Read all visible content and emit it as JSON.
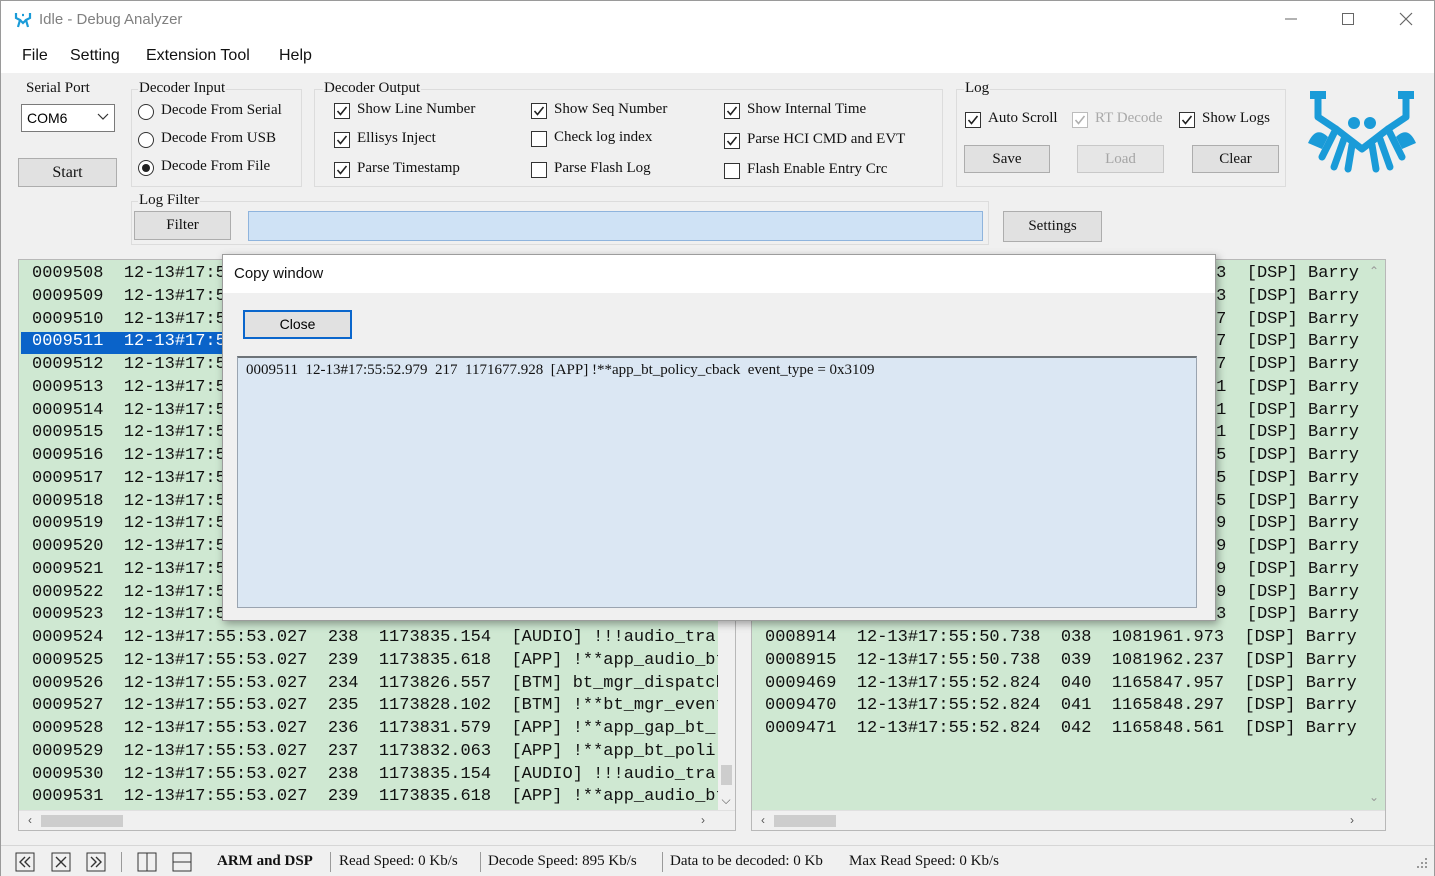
{
  "window": {
    "title": "Idle - Debug Analyzer",
    "minimize_icon": "minimize-icon",
    "maximize_icon": "maximize-icon",
    "close_icon": "close-icon"
  },
  "menu": [
    "File",
    "Setting",
    "Extension Tool",
    "Help"
  ],
  "serial_port": {
    "label": "Serial Port",
    "selected": "COM6",
    "start_label": "Start"
  },
  "decoder_input": {
    "label": "Decoder Input",
    "options": [
      {
        "label": "Decode From Serial",
        "checked": false
      },
      {
        "label": "Decode From USB",
        "checked": false
      },
      {
        "label": "Decode From File",
        "checked": true
      }
    ]
  },
  "decoder_output": {
    "label": "Decoder Output",
    "options": [
      {
        "label": "Show Line Number",
        "checked": true
      },
      {
        "label": "Ellisys Inject",
        "checked": true
      },
      {
        "label": "Parse Timestamp",
        "checked": true
      },
      {
        "label": "Show Seq Number",
        "checked": true
      },
      {
        "label": "Check log index",
        "checked": false
      },
      {
        "label": "Parse Flash Log",
        "checked": false
      },
      {
        "label": "Show Internal Time",
        "checked": true
      },
      {
        "label": "Parse HCI CMD and EVT",
        "checked": true
      },
      {
        "label": "Flash Enable Entry Crc",
        "checked": false
      }
    ]
  },
  "log": {
    "label": "Log",
    "auto_scroll": {
      "label": "Auto Scroll",
      "checked": true
    },
    "rt_decode": {
      "label": "RT Decode",
      "checked": true,
      "disabled": true
    },
    "show_logs": {
      "label": "Show Logs",
      "checked": true
    },
    "save_label": "Save",
    "load_label": "Load",
    "clear_label": "Clear"
  },
  "log_filter": {
    "label": "Log Filter",
    "filter_label": "Filter",
    "value": "",
    "settings_label": "Settings"
  },
  "left_log": {
    "lines": [
      "0009508  12-13#17:5",
      "0009509  12-13#17:5",
      "0009510  12-13#17:5",
      "0009511  12-13#17:5",
      "0009512  12-13#17:5",
      "0009513  12-13#17:5",
      "0009514  12-13#17:5",
      "0009515  12-13#17:5",
      "0009516  12-13#17:5",
      "0009517  12-13#17:5",
      "0009518  12-13#17:5",
      "0009519  12-13#17:5",
      "0009520  12-13#17:5",
      "0009521  12-13#17:5",
      "0009522  12-13#17:5",
      "0009523  12-13#17:5",
      "0009524  12-13#17:55:53.027  238  1173835.154  [AUDIO] !!!audio_tra",
      "0009525  12-13#17:55:53.027  239  1173835.618  [APP] !**app_audio_bt",
      "0009526  12-13#17:55:53.027  234  1173826.557  [BTM] bt_mgr_dispatch",
      "0009527  12-13#17:55:53.027  235  1173828.102  [BTM] !**bt_mgr_event",
      "0009528  12-13#17:55:53.027  236  1173831.579  [APP] !**app_gap_bt_",
      "0009529  12-13#17:55:53.027  237  1173832.063  [APP] !**app_bt_poli",
      "0009530  12-13#17:55:53.027  238  1173835.154  [AUDIO] !!!audio_tra",
      "0009531  12-13#17:55:53.027  239  1173835.618  [APP] !**app_audio_bt"
    ],
    "selected_index": 3
  },
  "right_log": {
    "lines": [
      "3  [DSP] Barry",
      "3  [DSP] Barry",
      "7  [DSP] Barry",
      "7  [DSP] Barry",
      "7  [DSP] Barry",
      "1  [DSP] Barry",
      "1  [DSP] Barry",
      "1  [DSP] Barry",
      "5  [DSP] Barry",
      "5  [DSP] Barry",
      "5  [DSP] Barry",
      "9  [DSP] Barry",
      "9  [DSP] Barry",
      "9  [DSP] Barry",
      "9  [DSP] Barry",
      "3  [DSP] Barry",
      "0008914  12-13#17:55:50.738  038  1081961.973  [DSP] Barry",
      "0008915  12-13#17:55:50.738  039  1081962.237  [DSP] Barry",
      "0009469  12-13#17:55:52.824  040  1165847.957  [DSP] Barry",
      "0009470  12-13#17:55:52.824  041  1165848.297  [DSP] Barry",
      "0009471  12-13#17:55:52.824  042  1165848.561  [DSP] Barry"
    ]
  },
  "copy_window": {
    "title": "Copy window",
    "close_label": "Close",
    "text": "0009511  12-13#17:55:52.979  217  1171677.928  [APP] !**app_bt_policy_cback  event_type = 0x3109"
  },
  "statusbar": {
    "mode": "ARM and DSP",
    "read_speed": "Read Speed:  0 Kb/s",
    "decode_speed": "Decode Speed:  895 Kb/s",
    "data_to_decode": "Data to be decoded:  0 Kb",
    "max_read_speed": "Max Read Speed:  0 Kb/s"
  },
  "colors": {
    "log_bg": "#cfe8d2",
    "selection": "#0a63c9",
    "filter_bg": "#cfe2f5",
    "logo": "#1a9bd8"
  }
}
